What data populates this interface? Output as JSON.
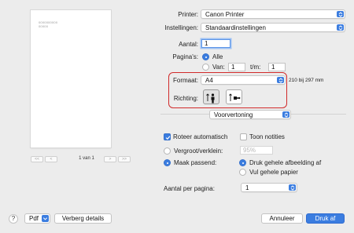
{
  "preview": {
    "line1": "0000000000",
    "line2": "00000",
    "page_count": "1 van 1",
    "first_label": "<<",
    "prev_label": "<",
    "next_label": ">",
    "last_label": ">>"
  },
  "printer": {
    "label": "Printer:",
    "value": "Canon Printer"
  },
  "presets": {
    "label": "Instellingen:",
    "value": "Standaardinstellingen"
  },
  "copies": {
    "label": "Aantal:",
    "value": "1"
  },
  "pages": {
    "label": "Pagina's:",
    "all_label": "Alle",
    "from_label": "Van:",
    "from_value": "1",
    "to_label": "t/m:",
    "to_value": "1",
    "selected": "all"
  },
  "paper": {
    "label": "Formaat:",
    "value": "A4",
    "size_text": "210 bij 297 mm"
  },
  "orientation": {
    "label": "Richting:",
    "selected": "portrait"
  },
  "section_popup": {
    "value": "Voorvertoning"
  },
  "options": {
    "auto_rotate_label": "Roteer automatisch",
    "auto_rotate_checked": true,
    "show_notes_label": "Toon notities",
    "show_notes_checked": false,
    "scale_label": "Vergroot/verklein:",
    "scale_value": "95%",
    "fit_label": "Maak passend:",
    "fit_print_entire": "Druk gehele afbeelding af",
    "fit_fill_paper": "Vul gehele papier",
    "per_page_label": "Aantal per pagina:",
    "per_page_value": "1"
  },
  "footer": {
    "help": "?",
    "pdf_label": "Pdf",
    "hide_details": "Verberg details",
    "cancel": "Annuleer",
    "print": "Druk af"
  },
  "colors": {
    "accent": "#3b7de0",
    "highlight_frame": "#d12a2a"
  }
}
